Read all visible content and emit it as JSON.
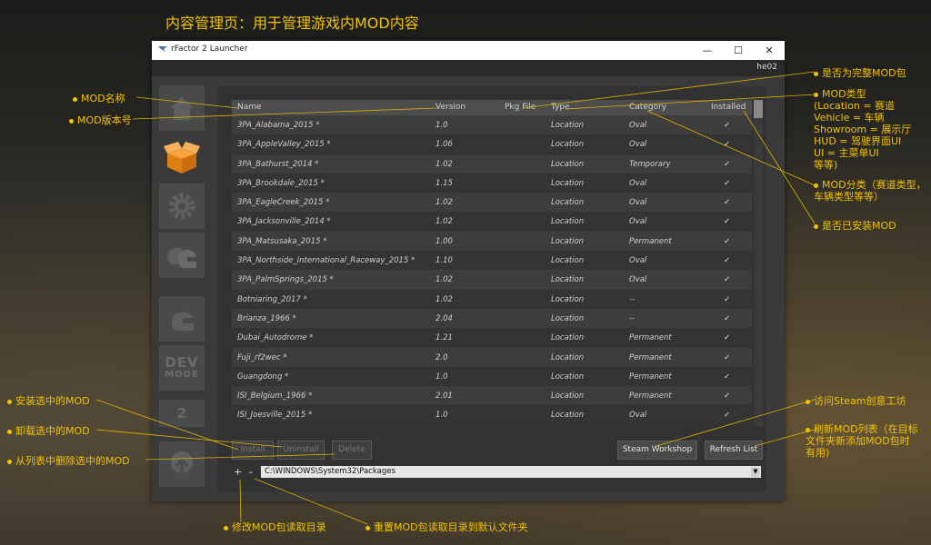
{
  "page_title": "内容管理页：用于管理游戏内MOD内容",
  "window": {
    "title": "rFactor 2 Launcher",
    "controls": {
      "minimize": "—",
      "maximize": "☐",
      "close": "✕"
    },
    "user": "he02"
  },
  "sidebar": {
    "items": [
      {
        "name": "home",
        "icon": "house-icon"
      },
      {
        "name": "content",
        "icon": "box-icon",
        "active": true
      },
      {
        "name": "settings",
        "icon": "gear-icon"
      },
      {
        "name": "multiplayer",
        "icon": "helmets-icon"
      },
      {
        "name": "single-player",
        "icon": "helmet-icon"
      },
      {
        "name": "dev-mode",
        "label_top": "DEV",
        "label_bottom": "MODE"
      },
      {
        "name": "rf2",
        "label": "2"
      },
      {
        "name": "update",
        "icon": "update-icon"
      }
    ]
  },
  "table": {
    "columns": [
      "Name",
      "Version",
      "Pkg File",
      "Type",
      "Category",
      "Installed"
    ],
    "rows": [
      {
        "name": "3PA_Alabama_2015 *",
        "version": "1.0",
        "type": "Location",
        "category": "Oval",
        "installed": "✓"
      },
      {
        "name": "3PA_AppleValley_2015 *",
        "version": "1.06",
        "type": "Location",
        "category": "Oval",
        "installed": "✓"
      },
      {
        "name": "3PA_Bathurst_2014 *",
        "version": "1.02",
        "type": "Location",
        "category": "Temporary",
        "installed": "✓"
      },
      {
        "name": "3PA_Brookdale_2015 *",
        "version": "1.15",
        "type": "Location",
        "category": "Oval",
        "installed": "✓"
      },
      {
        "name": "3PA_EagleCreek_2015 *",
        "version": "1.02",
        "type": "Location",
        "category": "Oval",
        "installed": "✓"
      },
      {
        "name": "3PA_Jacksonville_2014 *",
        "version": "1.02",
        "type": "Location",
        "category": "Oval",
        "installed": "✓"
      },
      {
        "name": "3PA_Matsusaka_2015 *",
        "version": "1.00",
        "type": "Location",
        "category": "Permanent",
        "installed": "✓"
      },
      {
        "name": "3PA_Northside_International_Raceway_2015 *",
        "version": "1.10",
        "type": "Location",
        "category": "Oval",
        "installed": "✓"
      },
      {
        "name": "3PA_PalmSprings_2015 *",
        "version": "1.02",
        "type": "Location",
        "category": "Oval",
        "installed": "✓"
      },
      {
        "name": "Botniaring_2017 *",
        "version": "1.02",
        "type": "Location",
        "category": "--",
        "installed": "✓"
      },
      {
        "name": "Brianza_1966 *",
        "version": "2.04",
        "type": "Location",
        "category": "--",
        "installed": "✓"
      },
      {
        "name": "Dubai_Autodrome *",
        "version": "1.21",
        "type": "Location",
        "category": "Permanent",
        "installed": "✓"
      },
      {
        "name": "Fuji_rf2wec *",
        "version": "2.0",
        "type": "Location",
        "category": "Permanent",
        "installed": "✓"
      },
      {
        "name": "Guangdong *",
        "version": "1.0",
        "type": "Location",
        "category": "Permanent",
        "installed": "✓"
      },
      {
        "name": "ISI_Belgium_1966 *",
        "version": "2.01",
        "type": "Location",
        "category": "Permanent",
        "installed": "✓"
      },
      {
        "name": "ISI_Joesville_2015 *",
        "version": "1.0",
        "type": "Location",
        "category": "Oval",
        "installed": "✓"
      }
    ]
  },
  "buttons": {
    "install": "Install",
    "uninstall": "Uninstall",
    "delete": "Delete",
    "steam_workshop": "Steam Workshop",
    "refresh_list": "Refresh List",
    "add_path": "+",
    "reset_path": "–"
  },
  "path": {
    "value": "C:\\WINDOWS\\System32\\Packages",
    "dropdown": "▼"
  },
  "annotations": {
    "mod_name": "MOD名称",
    "mod_version": "MOD版本号",
    "pkg_complete": "是否为完整MOD包",
    "mod_type_lines": [
      "MOD类型",
      "(Location = 赛道",
      "Vehicle = 车辆",
      "Showroom = 展示厅",
      "HUD = 驾驶界面UI",
      "UI = 主菜单UI",
      "等等)"
    ],
    "mod_category_lines": [
      "MOD分类（赛道类型，",
      "车辆类型等等）"
    ],
    "installed": "是否已安装MOD",
    "install_selected": "安装选中的MOD",
    "uninstall_selected": "卸载选中的MOD",
    "delete_selected": "从列表中删除选中的MOD",
    "steam_workshop": "访问Steam创意工坊",
    "refresh_lines": [
      "刷新MOD列表（在目标",
      "文件夹新添加MOD包时",
      "有用)"
    ],
    "modify_path": "修改MOD包读取目录",
    "reset_path": "重置MOD包读取目录到默认文件夹"
  },
  "colors": {
    "annotation": "#f2c300",
    "window_bg": "#3a3a3a",
    "accent_box": "#f08a1c"
  }
}
